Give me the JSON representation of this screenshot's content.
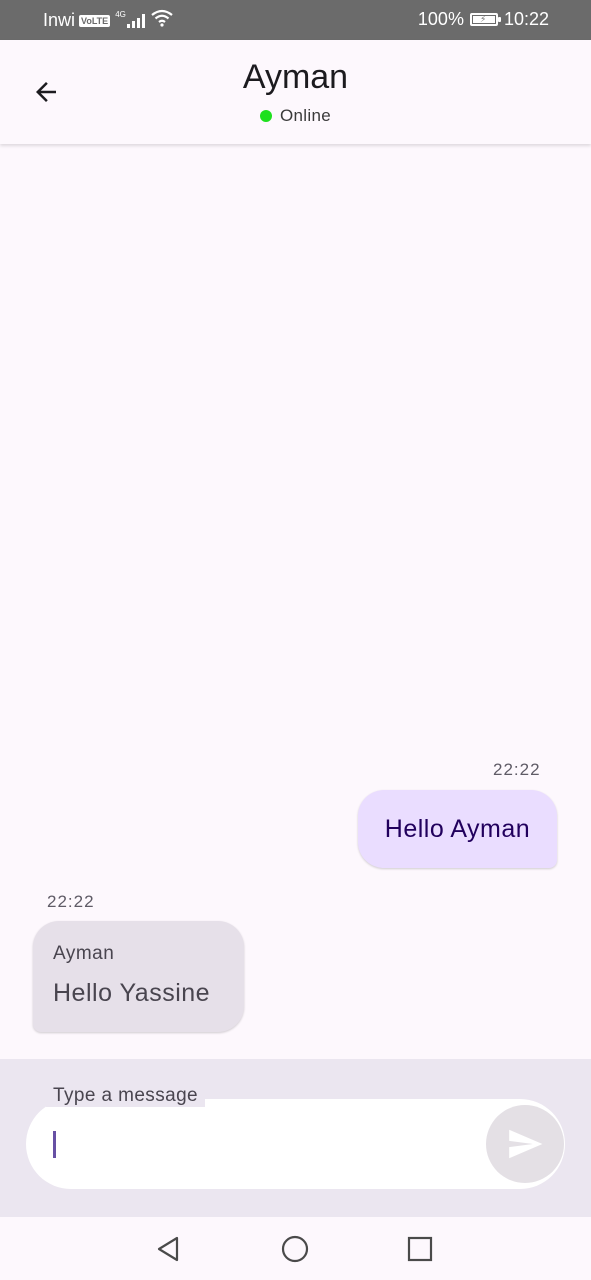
{
  "status_bar": {
    "carrier": "Inwi",
    "volte": "VoLTE",
    "network": "4G",
    "battery": "100%",
    "time": "10:22",
    "icons": [
      "signal-icon",
      "wifi-icon",
      "battery-icon"
    ]
  },
  "header": {
    "back_icon": "arrow-back-icon",
    "contact_name": "Ayman",
    "presence": "Online",
    "presence_color": "#1ee01e"
  },
  "messages": [
    {
      "direction": "sent",
      "time": "22:22",
      "text": "Hello Ayman"
    },
    {
      "direction": "received",
      "time": "22:22",
      "sender": "Ayman",
      "text": "Hello Yassine"
    }
  ],
  "composer": {
    "label": "Type a message",
    "value": "",
    "send_icon": "send-icon"
  },
  "nav_bar": {
    "icons": [
      "nav-back-icon",
      "nav-home-icon",
      "nav-recents-icon"
    ]
  },
  "colors": {
    "sent_bubble": "#eaddff",
    "received_bubble": "#e6e0e9",
    "accent": "#6750a4"
  }
}
